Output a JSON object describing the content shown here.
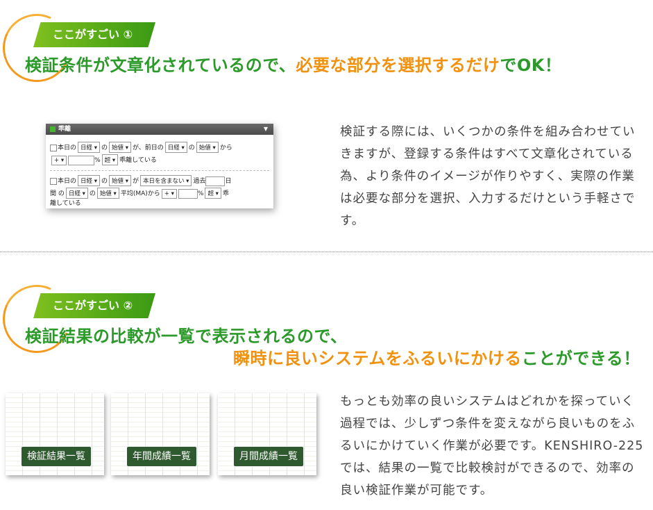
{
  "section1": {
    "ribbon": "ここがすごい ①",
    "headline_green": "検証条件が文章化されているので、",
    "headline_orange": "必要な部分を選択するだけ",
    "headline_green2": "でOK！",
    "body": "検証する際には、いくつかの条件を組み合わせていきますが、登録する条件はすべて文章化されている為、より条件のイメージが作りやすく、実際の作業は必要な部分を選択、入力するだけという手軽さです。",
    "panel": {
      "title": "乖離",
      "r1_t1": "本日の",
      "r1_s1": "日経 ▾",
      "r1_t2": "の",
      "r1_s2": "始値 ▾",
      "r1_t3": "が、前日の",
      "r1_s3": "日経 ▾",
      "r1_t4": "の",
      "r1_s4": "始値 ▾",
      "r1_t5": "から",
      "r2_s1": "+ ▾",
      "r2_t1": "%",
      "r2_s2": "超 ▾",
      "r2_t2": "乖離している",
      "r3_t1": "本日の",
      "r3_s1": "日経 ▾",
      "r3_t2": "の",
      "r3_s2": "始値 ▾",
      "r3_t3": "が",
      "r3_s3": "本日を含まない ▾",
      "r3_t4": "過去",
      "r3_t5": "日",
      "r4_t1": "間 の",
      "r4_s1": "日経 ▾",
      "r4_t2": "の",
      "r4_s2": "始値 ▾",
      "r4_t3": "平均(MA)から",
      "r4_s3": "+ ▾",
      "r4_t4": "%",
      "r4_s4": "超 ▾",
      "r4_t5": "乖",
      "r5_t1": "離している"
    }
  },
  "section2": {
    "ribbon": "ここがすごい ②",
    "headline_line1": "検証結果の比較が一覧で表示されるので、",
    "headline_orange": "瞬時に良いシステムをふるいにかける",
    "headline_green2": "ことができる！",
    "body": "もっとも効率の良いシステムはどれかを探っていく過程では、少しずつ条件を変えながら良いものをふるいにかけていく作業が必要です。KENSHIRO-225では、結果の一覧で比較検討ができるので、効率の良い検証作業が可能です。",
    "thumbs": [
      "検証結果一覧",
      "年間成績一覧",
      "月間成績一覧"
    ]
  },
  "colors": {
    "green": "#2c9a2a",
    "orange": "#f0920f"
  }
}
